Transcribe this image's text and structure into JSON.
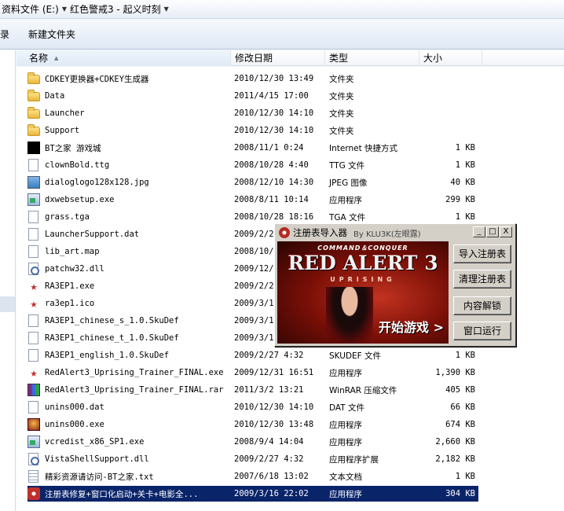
{
  "address": {
    "crumbs": [
      "资料文件 (E:)",
      "红色警戒3 - 起义时刻"
    ]
  },
  "toolbar": {
    "partial_left": "录",
    "new_folder": "新建文件夹"
  },
  "columns": {
    "name": "名称",
    "date": "修改日期",
    "type": "类型",
    "size": "大小"
  },
  "files": [
    {
      "icon": "folder-icon",
      "name": "CDKEY更换器+CDKEY生成器",
      "date": "2010/12/30 13:49",
      "type": "文件夹",
      "size": ""
    },
    {
      "icon": "folder-icon",
      "name": "Data",
      "date": "2011/4/15 17:00",
      "type": "文件夹",
      "size": ""
    },
    {
      "icon": "folder-icon",
      "name": "Launcher",
      "date": "2010/12/30 14:10",
      "type": "文件夹",
      "size": ""
    },
    {
      "icon": "folder-icon",
      "name": "Support",
      "date": "2010/12/30 14:10",
      "type": "文件夹",
      "size": ""
    },
    {
      "icon": "shortcut-icon",
      "name": "BT之家 游戏城",
      "date": "2008/11/1 0:24",
      "type": "Internet 快捷方式",
      "size": "1 KB"
    },
    {
      "icon": "document-icon",
      "name": "clownBold.ttg",
      "date": "2008/10/28 4:40",
      "type": "TTG 文件",
      "size": "1 KB"
    },
    {
      "icon": "image-icon",
      "name": "dialoglogo128x128.jpg",
      "date": "2008/12/10 14:30",
      "type": "JPEG 图像",
      "size": "40 KB"
    },
    {
      "icon": "application-icon",
      "name": "dxwebsetup.exe",
      "date": "2008/8/11 10:14",
      "type": "应用程序",
      "size": "299 KB"
    },
    {
      "icon": "document-icon",
      "name": "grass.tga",
      "date": "2008/10/28 18:16",
      "type": "TGA 文件",
      "size": "1 KB"
    },
    {
      "icon": "document-icon",
      "name": "LauncherSupport.dat",
      "date": "2009/2/27",
      "type": "",
      "size": ""
    },
    {
      "icon": "document-icon",
      "name": "lib_art.map",
      "date": "2008/10/2",
      "type": "",
      "size": ""
    },
    {
      "icon": "dll-icon",
      "name": "patchw32.dll",
      "date": "2009/12/1",
      "type": "",
      "size": ""
    },
    {
      "icon": "red-star-icon",
      "name": "RA3EP1.exe",
      "date": "2009/2/27",
      "type": "",
      "size": ""
    },
    {
      "icon": "red-star-icon",
      "name": "ra3ep1.ico",
      "date": "2009/3/15",
      "type": "",
      "size": ""
    },
    {
      "icon": "document-icon",
      "name": "RA3EP1_chinese_s_1.0.SkuDef",
      "date": "2009/3/15",
      "type": "",
      "size": ""
    },
    {
      "icon": "document-icon",
      "name": "RA3EP1_chinese_t_1.0.SkuDef",
      "date": "2009/3/15",
      "type": "",
      "size": ""
    },
    {
      "icon": "document-icon",
      "name": "RA3EP1_english_1.0.SkuDef",
      "date": "2009/2/27 4:32",
      "type": "SKUDEF 文件",
      "size": "1 KB"
    },
    {
      "icon": "red-star-icon",
      "name": "RedAlert3_Uprising_Trainer_FINAL.exe",
      "date": "2009/12/31 16:51",
      "type": "应用程序",
      "size": "1,390 KB"
    },
    {
      "icon": "winrar-icon",
      "name": "RedAlert3_Uprising_Trainer_FINAL.rar",
      "date": "2011/3/2 13:21",
      "type": "WinRAR 压缩文件",
      "size": "405 KB"
    },
    {
      "icon": "document-icon",
      "name": "unins000.dat",
      "date": "2010/12/30 14:10",
      "type": "DAT 文件",
      "size": "66 KB"
    },
    {
      "icon": "game-icon",
      "name": "unins000.exe",
      "date": "2010/12/30 13:48",
      "type": "应用程序",
      "size": "674 KB"
    },
    {
      "icon": "application-icon",
      "name": "vcredist_x86_SP1.exe",
      "date": "2008/9/4 14:04",
      "type": "应用程序",
      "size": "2,660 KB"
    },
    {
      "icon": "dll-icon",
      "name": "VistaShellSupport.dll",
      "date": "2009/2/27 4:32",
      "type": "应用程序扩展",
      "size": "2,182 KB"
    },
    {
      "icon": "text-file-icon",
      "name": "精彩资源请访问-BT之家.txt",
      "date": "2007/6/18 13:02",
      "type": "文本文档",
      "size": "1 KB"
    },
    {
      "icon": "registry-app-icon",
      "name": "注册表修复+窗口化启动+关卡+电影全...",
      "date": "2009/3/16 22:02",
      "type": "应用程序",
      "size": "304 KB",
      "selected": true
    }
  ],
  "popup": {
    "title": "注册表导入器",
    "by": "By KLU3K(左眼露)",
    "window_buttons": {
      "minimize": "_",
      "maximize": "□",
      "close": "X"
    },
    "banner": {
      "brand": "COMMAND＆CONQUER",
      "game": "RED ALERT 3",
      "edition": "UPRISING",
      "start": "开始游戏 >"
    },
    "buttons": [
      "导入注册表",
      "清理注册表",
      "内容解锁",
      "窗口运行"
    ]
  }
}
